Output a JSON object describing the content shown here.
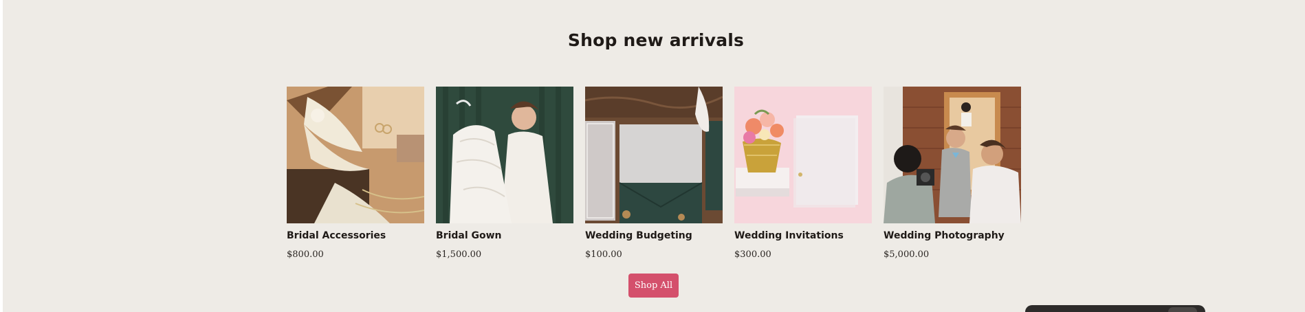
{
  "section": {
    "title": "Shop new arrivals"
  },
  "products": [
    {
      "name": "Bridal Accessories",
      "price": "$800.00"
    },
    {
      "name": "Bridal Gown",
      "price": "$1,500.00"
    },
    {
      "name": "Wedding Budgeting",
      "price": "$100.00"
    },
    {
      "name": "Wedding Invitations",
      "price": "$300.00"
    },
    {
      "name": "Wedding Photography",
      "price": "$5,000.00"
    }
  ],
  "shop_all": {
    "label": "Shop All"
  },
  "colors": {
    "page_background": "#eeebe6",
    "button": "#d4506c",
    "text": "#1f1a17"
  }
}
